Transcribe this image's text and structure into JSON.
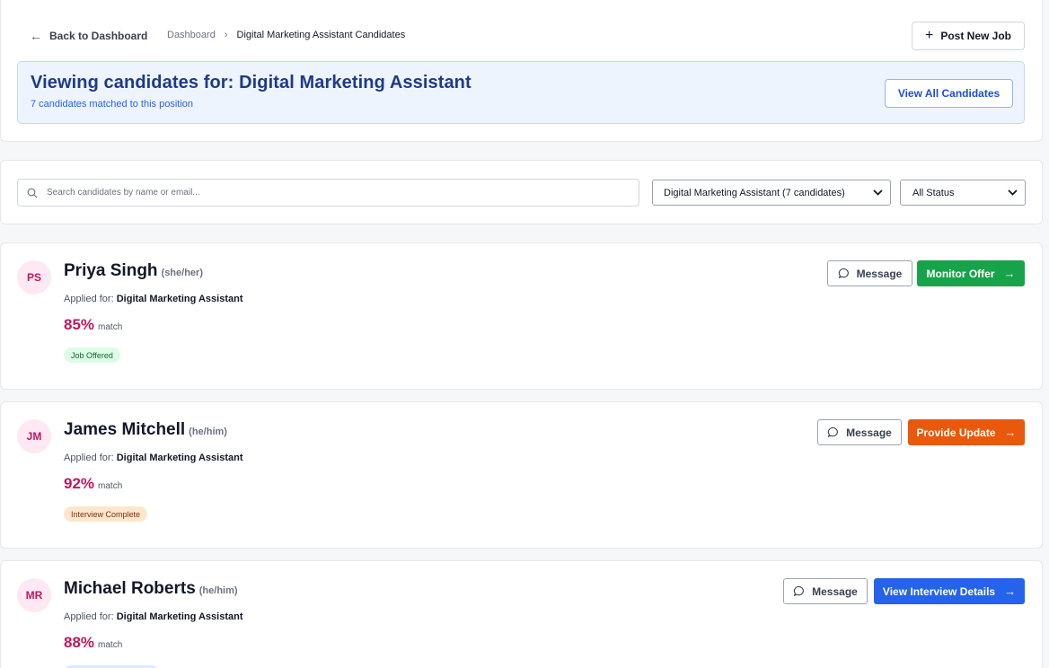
{
  "header": {
    "back_label": "Back to Dashboard",
    "breadcrumb": {
      "root": "Dashboard",
      "current": "Digital Marketing Assistant Candidates"
    },
    "post_job_label": "Post New Job"
  },
  "banner": {
    "title": "Viewing candidates for: Digital Marketing Assistant",
    "subtitle": "7 candidates matched to this position",
    "view_all_label": "View All Candidates"
  },
  "filters": {
    "search_placeholder": "Search candidates by name or email...",
    "job_selected": "Digital Marketing Assistant (7 candidates)",
    "status_selected": "All Status"
  },
  "candidates": [
    {
      "initials": "PS",
      "name": "Priya Singh",
      "pronouns": "(she/her)",
      "applied_label": "Applied for:",
      "job": "Digital Marketing Assistant",
      "match_pct": "85%",
      "match_label": "match",
      "status": "Job Offered",
      "status_color": "#dcfce7",
      "message_label": "Message",
      "action_label": "Monitor Offer",
      "action_color": "#16a34a"
    },
    {
      "initials": "JM",
      "name": "James Mitchell",
      "pronouns": "(he/him)",
      "applied_label": "Applied for:",
      "job": "Digital Marketing Assistant",
      "match_pct": "92%",
      "match_label": "match",
      "status": "Interview Complete",
      "status_color": "#fde7cc",
      "message_label": "Message",
      "action_label": "Provide Update",
      "action_color": "#ea580c"
    },
    {
      "initials": "MR",
      "name": "Michael Roberts",
      "pronouns": "(he/him)",
      "applied_label": "Applied for:",
      "job": "Digital Marketing Assistant",
      "match_pct": "88%",
      "match_label": "match",
      "status": "",
      "status_color": "#dbeafe",
      "message_label": "Message",
      "action_label": "View Interview Details",
      "action_color": "#2563eb"
    }
  ],
  "icons": {
    "back": "arrow-left-icon",
    "breadcrumb_sep": "chevron-right-icon",
    "post": "plus-icon",
    "search": "search-icon",
    "select": "chevron-down-icon",
    "message": "chat-bubble-icon",
    "action": "arrow-right-icon"
  }
}
